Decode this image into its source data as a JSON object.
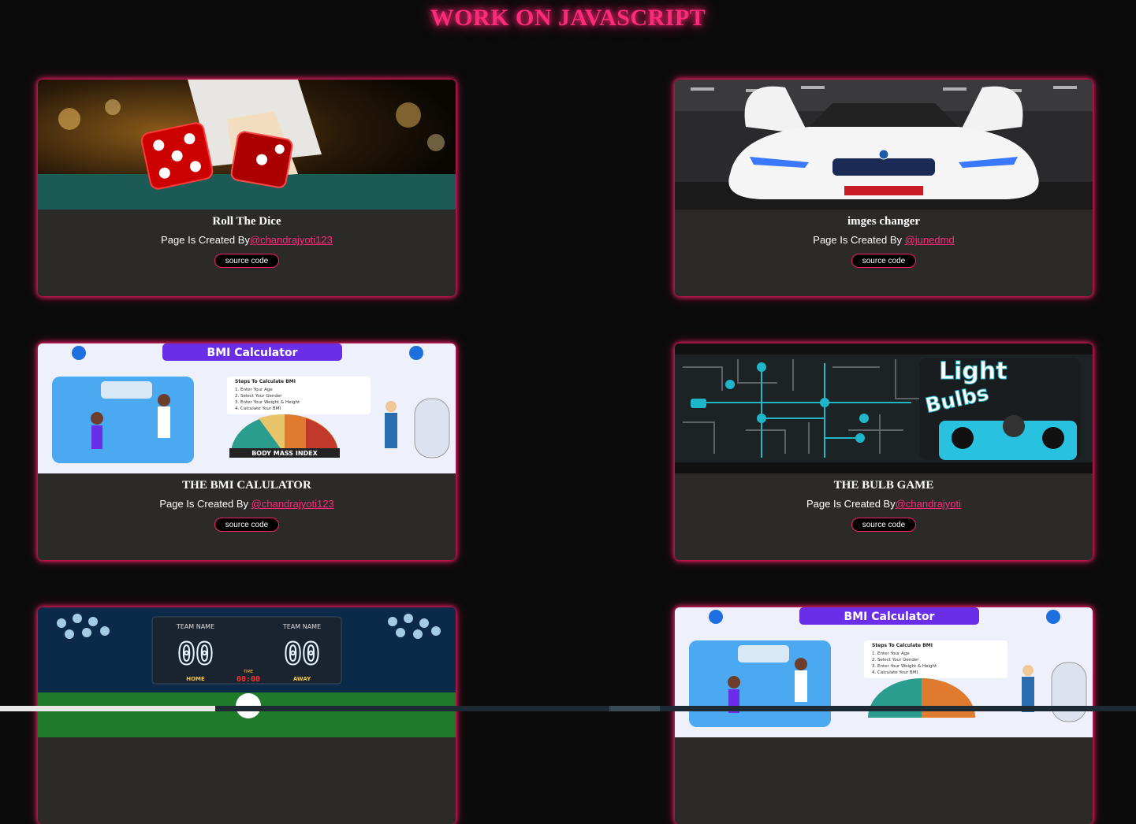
{
  "page": {
    "title": "WORK ON JAVASCRIPT"
  },
  "cards": [
    {
      "title": "Roll The Dice",
      "credit_prefix": "Page Is Created By",
      "author": "@chandrajyoti123",
      "button": "source code",
      "image": "dice-casino-image"
    },
    {
      "title": "imges changer",
      "credit_prefix": "Page Is Created By ",
      "author": "@junedmd",
      "button": "source code",
      "image": "white-sports-car-image"
    },
    {
      "title": "THE BMI CALULATOR",
      "credit_prefix": "Page Is Created By ",
      "author": "@chandrajyoti123",
      "button": "source code",
      "image": "bmi-calculator-image"
    },
    {
      "title": "THE BULB GAME",
      "credit_prefix": "Page Is Created By",
      "author": "@chandrajyoti",
      "button": "source code",
      "image": "light-bulbs-game-image"
    },
    {
      "title": "",
      "credit_prefix": "",
      "author": "",
      "button": "",
      "image": "scoreboard-image"
    },
    {
      "title": "",
      "credit_prefix": "",
      "author": "",
      "button": "",
      "image": "bmi-calculator-image"
    }
  ],
  "image_text": {
    "bmi_banner": "BMI Calculator",
    "bmi_steps_title": "Steps To Calculate BMI",
    "bmi_steps": [
      "1. Enter Your Age",
      "2. Select Your Gender",
      "3. Enter Your Weight & Height",
      "4. Calculate Your BMI"
    ],
    "bmi_gauge": "BODY MASS INDEX",
    "bulb_word1": "Light",
    "bulb_word2": "Bulbs",
    "score_team": "TEAM NAME",
    "score_value": "00",
    "score_home": "HOME",
    "score_away": "AWAY",
    "score_time_label": "TIME",
    "score_time": "00:00"
  },
  "colors": {
    "accent": "#ff1f6a",
    "background": "#0b0b0b",
    "card": "#2b2a29"
  }
}
